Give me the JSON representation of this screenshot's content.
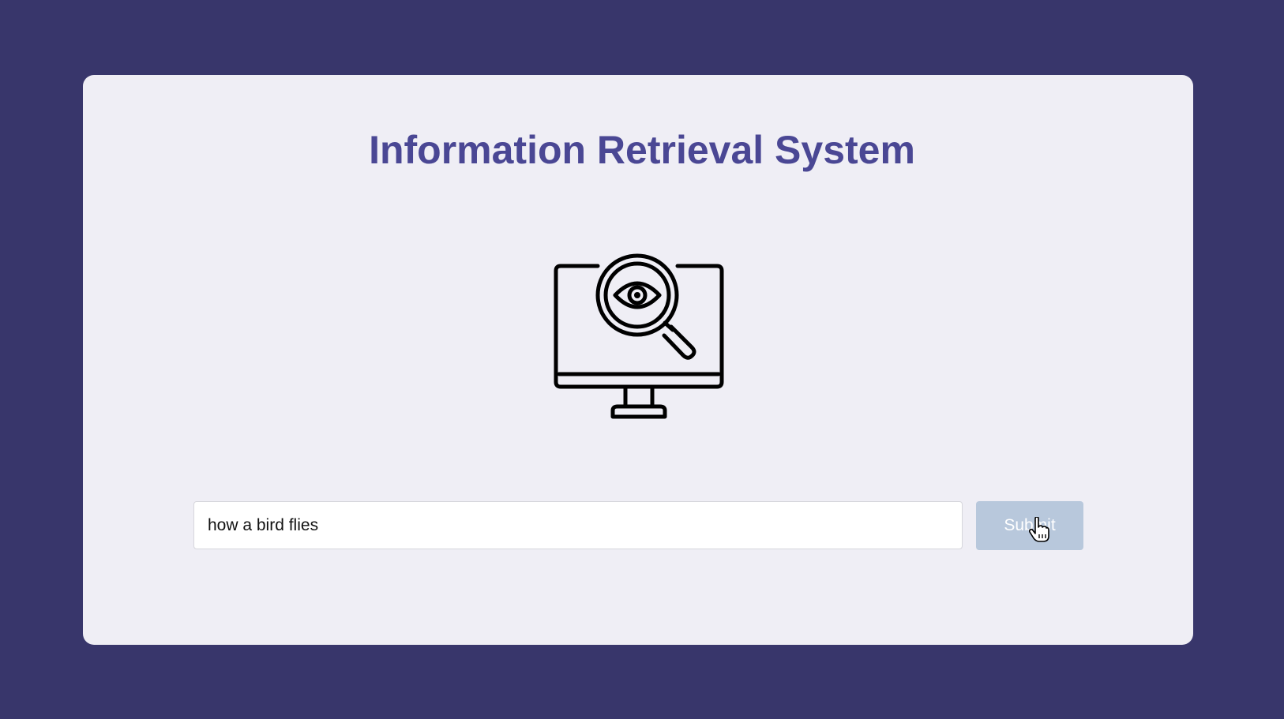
{
  "app": {
    "title": "Information Retrieval System"
  },
  "illustration": {
    "icon": "monitor-magnifier-eye-icon"
  },
  "search": {
    "value": "how a bird flies",
    "placeholder": ""
  },
  "submit": {
    "label": "Submit"
  },
  "colors": {
    "background": "#38366b",
    "card": "#efeef5",
    "title": "#4a4794",
    "button": "#b8c8dc",
    "button_text": "#ffffff"
  }
}
